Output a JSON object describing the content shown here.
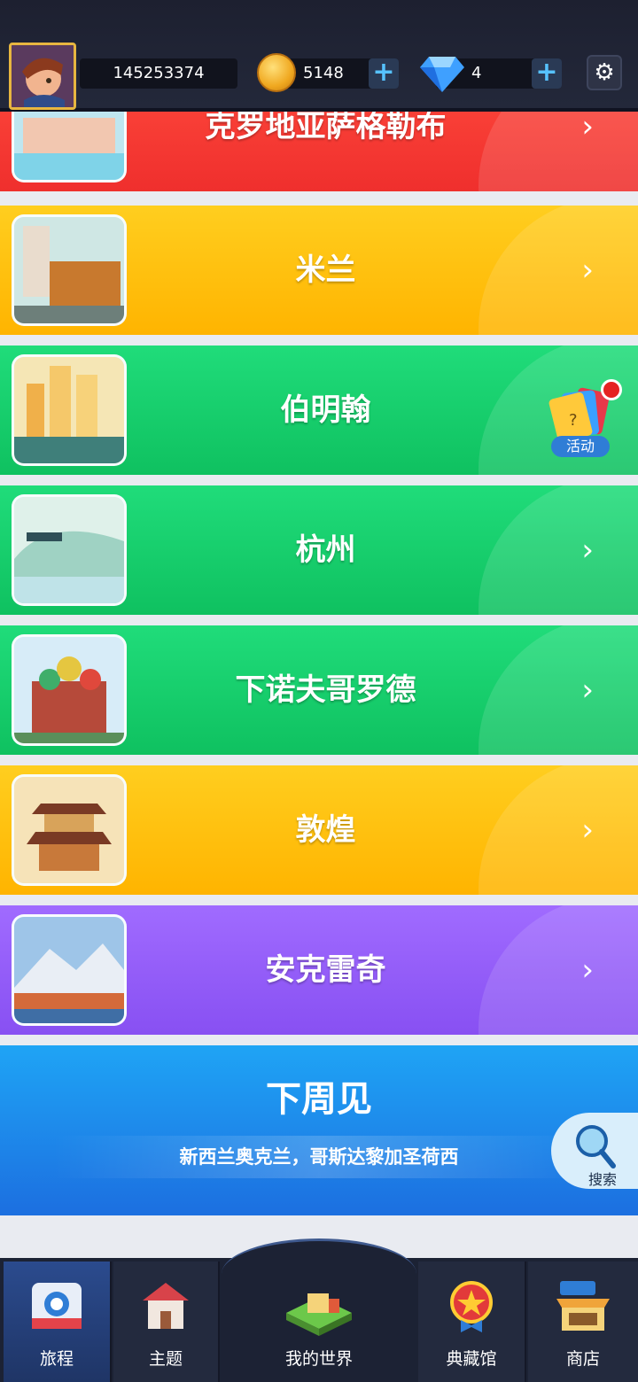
{
  "header": {
    "player_id": "145253374",
    "coins": "5148",
    "gems": "4",
    "add_label": "+",
    "settings_icon": "gear-icon"
  },
  "cities": [
    {
      "name": "克罗地亚萨格勒布",
      "color": "red"
    },
    {
      "name": "米兰",
      "color": "yellow"
    },
    {
      "name": "伯明翰",
      "color": "green",
      "badge": "活动"
    },
    {
      "name": "杭州",
      "color": "green"
    },
    {
      "name": "下诺夫哥罗德",
      "color": "green"
    },
    {
      "name": "敦煌",
      "color": "yellow"
    },
    {
      "name": "安克雷奇",
      "color": "purple"
    }
  ],
  "chevron": "›",
  "next_week": {
    "title": "下周见",
    "subtitle": "新西兰奥克兰，哥斯达黎加圣荷西"
  },
  "search": {
    "label": "搜索"
  },
  "nav": {
    "items": [
      {
        "label": "旅程",
        "icon": "journey-icon"
      },
      {
        "label": "主题",
        "icon": "house-icon"
      },
      {
        "label": "我的世界",
        "icon": "world-icon"
      },
      {
        "label": "典藏馆",
        "icon": "medal-icon"
      },
      {
        "label": "商店",
        "icon": "shop-icon"
      }
    ]
  }
}
